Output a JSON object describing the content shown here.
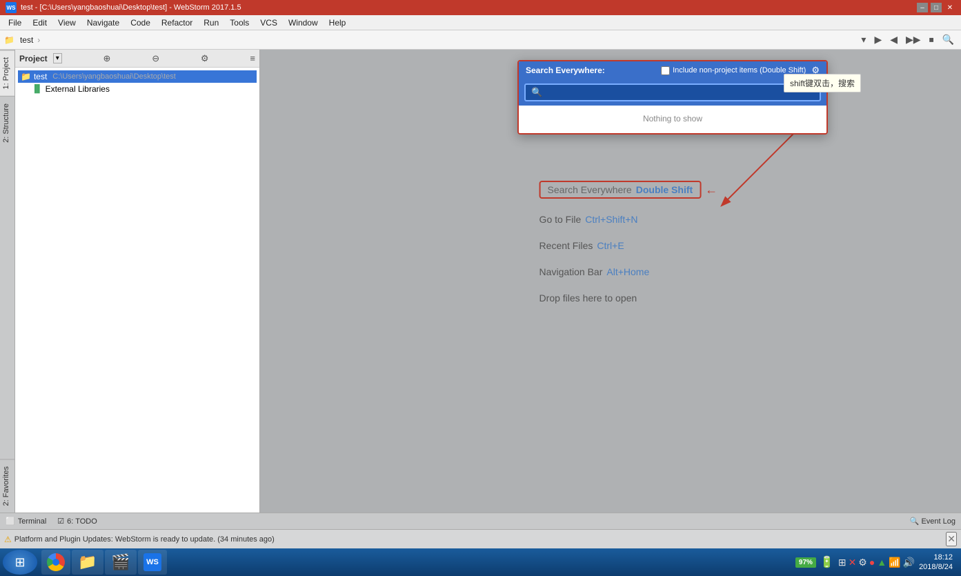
{
  "titleBar": {
    "title": "test - [C:\\Users\\yangbaoshuai\\Desktop\\test] - WebStorm 2017.1.5",
    "icon": "WS",
    "minBtn": "–",
    "maxBtn": "□",
    "closeBtn": "✕"
  },
  "menuBar": {
    "items": [
      "File",
      "Edit",
      "View",
      "Navigate",
      "Code",
      "Refactor",
      "Run",
      "Tools",
      "VCS",
      "Window",
      "Help"
    ]
  },
  "navBar": {
    "folder": "test",
    "separator": "›"
  },
  "sidebar": {
    "tabs": [
      {
        "id": "project",
        "label": "1: Project"
      },
      {
        "id": "structure",
        "label": "2: Structure"
      },
      {
        "id": "favorites",
        "label": "2: Favorites"
      }
    ]
  },
  "projectPanel": {
    "title": "Project",
    "items": [
      {
        "type": "folder",
        "name": "test",
        "path": "C:\\Users\\yangbaoshuai\\Desktop\\test",
        "selected": true
      },
      {
        "type": "extlib",
        "name": "External Libraries"
      }
    ]
  },
  "searchPopup": {
    "label": "Search Everywhere:",
    "checkboxLabel": "Include non-project items (Double Shift)",
    "placeholder": "",
    "noResults": "Nothing to show"
  },
  "annotation": {
    "text": "shift键双击，搜索"
  },
  "mainContent": {
    "searchEverywhereLabel": "Search Everywhere",
    "searchEverywhereShortcut": "Double Shift",
    "gotoFile": "Go to File",
    "gotoFileShortcut": "Ctrl+Shift+N",
    "recentFiles": "Recent Files",
    "recentFilesShortcut": "Ctrl+E",
    "navBar": "Navigation Bar",
    "navBarShortcut": "Alt+Home",
    "dropFiles": "Drop files here to open"
  },
  "bottomPanel": {
    "terminal": "Terminal",
    "todo": "6: TODO",
    "eventLog": "Event Log"
  },
  "statusBar": {
    "icon": "⚠",
    "text": "Platform and Plugin Updates: WebStorm is ready to update. (34 minutes ago)"
  },
  "taskbar": {
    "battery": "97%",
    "time": "18:12",
    "date": "2018/8/24",
    "icons": [
      "⊞",
      "🌐",
      "💾",
      "🎬",
      "WS"
    ]
  }
}
